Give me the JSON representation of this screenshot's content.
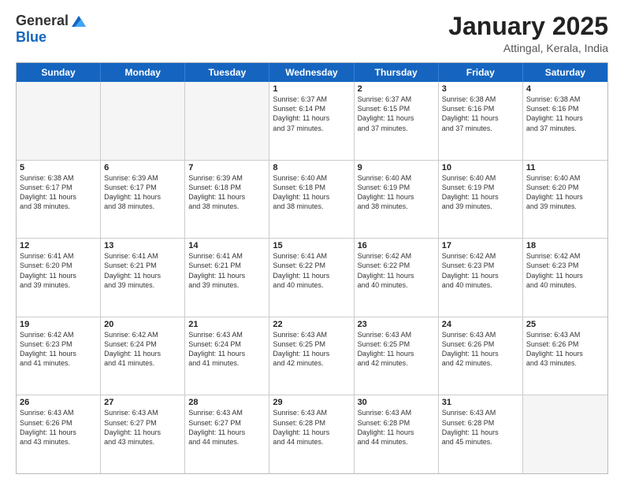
{
  "logo": {
    "general": "General",
    "blue": "Blue"
  },
  "title": {
    "month": "January 2025",
    "location": "Attingal, Kerala, India"
  },
  "header": {
    "days": [
      "Sunday",
      "Monday",
      "Tuesday",
      "Wednesday",
      "Thursday",
      "Friday",
      "Saturday"
    ]
  },
  "weeks": [
    [
      {
        "day": "",
        "info": "",
        "empty": true
      },
      {
        "day": "",
        "info": "",
        "empty": true
      },
      {
        "day": "",
        "info": "",
        "empty": true
      },
      {
        "day": "1",
        "info": "Sunrise: 6:37 AM\nSunset: 6:14 PM\nDaylight: 11 hours\nand 37 minutes.",
        "empty": false
      },
      {
        "day": "2",
        "info": "Sunrise: 6:37 AM\nSunset: 6:15 PM\nDaylight: 11 hours\nand 37 minutes.",
        "empty": false
      },
      {
        "day": "3",
        "info": "Sunrise: 6:38 AM\nSunset: 6:16 PM\nDaylight: 11 hours\nand 37 minutes.",
        "empty": false
      },
      {
        "day": "4",
        "info": "Sunrise: 6:38 AM\nSunset: 6:16 PM\nDaylight: 11 hours\nand 37 minutes.",
        "empty": false
      }
    ],
    [
      {
        "day": "5",
        "info": "Sunrise: 6:38 AM\nSunset: 6:17 PM\nDaylight: 11 hours\nand 38 minutes.",
        "empty": false
      },
      {
        "day": "6",
        "info": "Sunrise: 6:39 AM\nSunset: 6:17 PM\nDaylight: 11 hours\nand 38 minutes.",
        "empty": false
      },
      {
        "day": "7",
        "info": "Sunrise: 6:39 AM\nSunset: 6:18 PM\nDaylight: 11 hours\nand 38 minutes.",
        "empty": false
      },
      {
        "day": "8",
        "info": "Sunrise: 6:40 AM\nSunset: 6:18 PM\nDaylight: 11 hours\nand 38 minutes.",
        "empty": false
      },
      {
        "day": "9",
        "info": "Sunrise: 6:40 AM\nSunset: 6:19 PM\nDaylight: 11 hours\nand 38 minutes.",
        "empty": false
      },
      {
        "day": "10",
        "info": "Sunrise: 6:40 AM\nSunset: 6:19 PM\nDaylight: 11 hours\nand 39 minutes.",
        "empty": false
      },
      {
        "day": "11",
        "info": "Sunrise: 6:40 AM\nSunset: 6:20 PM\nDaylight: 11 hours\nand 39 minutes.",
        "empty": false
      }
    ],
    [
      {
        "day": "12",
        "info": "Sunrise: 6:41 AM\nSunset: 6:20 PM\nDaylight: 11 hours\nand 39 minutes.",
        "empty": false
      },
      {
        "day": "13",
        "info": "Sunrise: 6:41 AM\nSunset: 6:21 PM\nDaylight: 11 hours\nand 39 minutes.",
        "empty": false
      },
      {
        "day": "14",
        "info": "Sunrise: 6:41 AM\nSunset: 6:21 PM\nDaylight: 11 hours\nand 39 minutes.",
        "empty": false
      },
      {
        "day": "15",
        "info": "Sunrise: 6:41 AM\nSunset: 6:22 PM\nDaylight: 11 hours\nand 40 minutes.",
        "empty": false
      },
      {
        "day": "16",
        "info": "Sunrise: 6:42 AM\nSunset: 6:22 PM\nDaylight: 11 hours\nand 40 minutes.",
        "empty": false
      },
      {
        "day": "17",
        "info": "Sunrise: 6:42 AM\nSunset: 6:23 PM\nDaylight: 11 hours\nand 40 minutes.",
        "empty": false
      },
      {
        "day": "18",
        "info": "Sunrise: 6:42 AM\nSunset: 6:23 PM\nDaylight: 11 hours\nand 40 minutes.",
        "empty": false
      }
    ],
    [
      {
        "day": "19",
        "info": "Sunrise: 6:42 AM\nSunset: 6:23 PM\nDaylight: 11 hours\nand 41 minutes.",
        "empty": false
      },
      {
        "day": "20",
        "info": "Sunrise: 6:42 AM\nSunset: 6:24 PM\nDaylight: 11 hours\nand 41 minutes.",
        "empty": false
      },
      {
        "day": "21",
        "info": "Sunrise: 6:43 AM\nSunset: 6:24 PM\nDaylight: 11 hours\nand 41 minutes.",
        "empty": false
      },
      {
        "day": "22",
        "info": "Sunrise: 6:43 AM\nSunset: 6:25 PM\nDaylight: 11 hours\nand 42 minutes.",
        "empty": false
      },
      {
        "day": "23",
        "info": "Sunrise: 6:43 AM\nSunset: 6:25 PM\nDaylight: 11 hours\nand 42 minutes.",
        "empty": false
      },
      {
        "day": "24",
        "info": "Sunrise: 6:43 AM\nSunset: 6:26 PM\nDaylight: 11 hours\nand 42 minutes.",
        "empty": false
      },
      {
        "day": "25",
        "info": "Sunrise: 6:43 AM\nSunset: 6:26 PM\nDaylight: 11 hours\nand 43 minutes.",
        "empty": false
      }
    ],
    [
      {
        "day": "26",
        "info": "Sunrise: 6:43 AM\nSunset: 6:26 PM\nDaylight: 11 hours\nand 43 minutes.",
        "empty": false
      },
      {
        "day": "27",
        "info": "Sunrise: 6:43 AM\nSunset: 6:27 PM\nDaylight: 11 hours\nand 43 minutes.",
        "empty": false
      },
      {
        "day": "28",
        "info": "Sunrise: 6:43 AM\nSunset: 6:27 PM\nDaylight: 11 hours\nand 44 minutes.",
        "empty": false
      },
      {
        "day": "29",
        "info": "Sunrise: 6:43 AM\nSunset: 6:28 PM\nDaylight: 11 hours\nand 44 minutes.",
        "empty": false
      },
      {
        "day": "30",
        "info": "Sunrise: 6:43 AM\nSunset: 6:28 PM\nDaylight: 11 hours\nand 44 minutes.",
        "empty": false
      },
      {
        "day": "31",
        "info": "Sunrise: 6:43 AM\nSunset: 6:28 PM\nDaylight: 11 hours\nand 45 minutes.",
        "empty": false
      },
      {
        "day": "",
        "info": "",
        "empty": true
      }
    ]
  ]
}
